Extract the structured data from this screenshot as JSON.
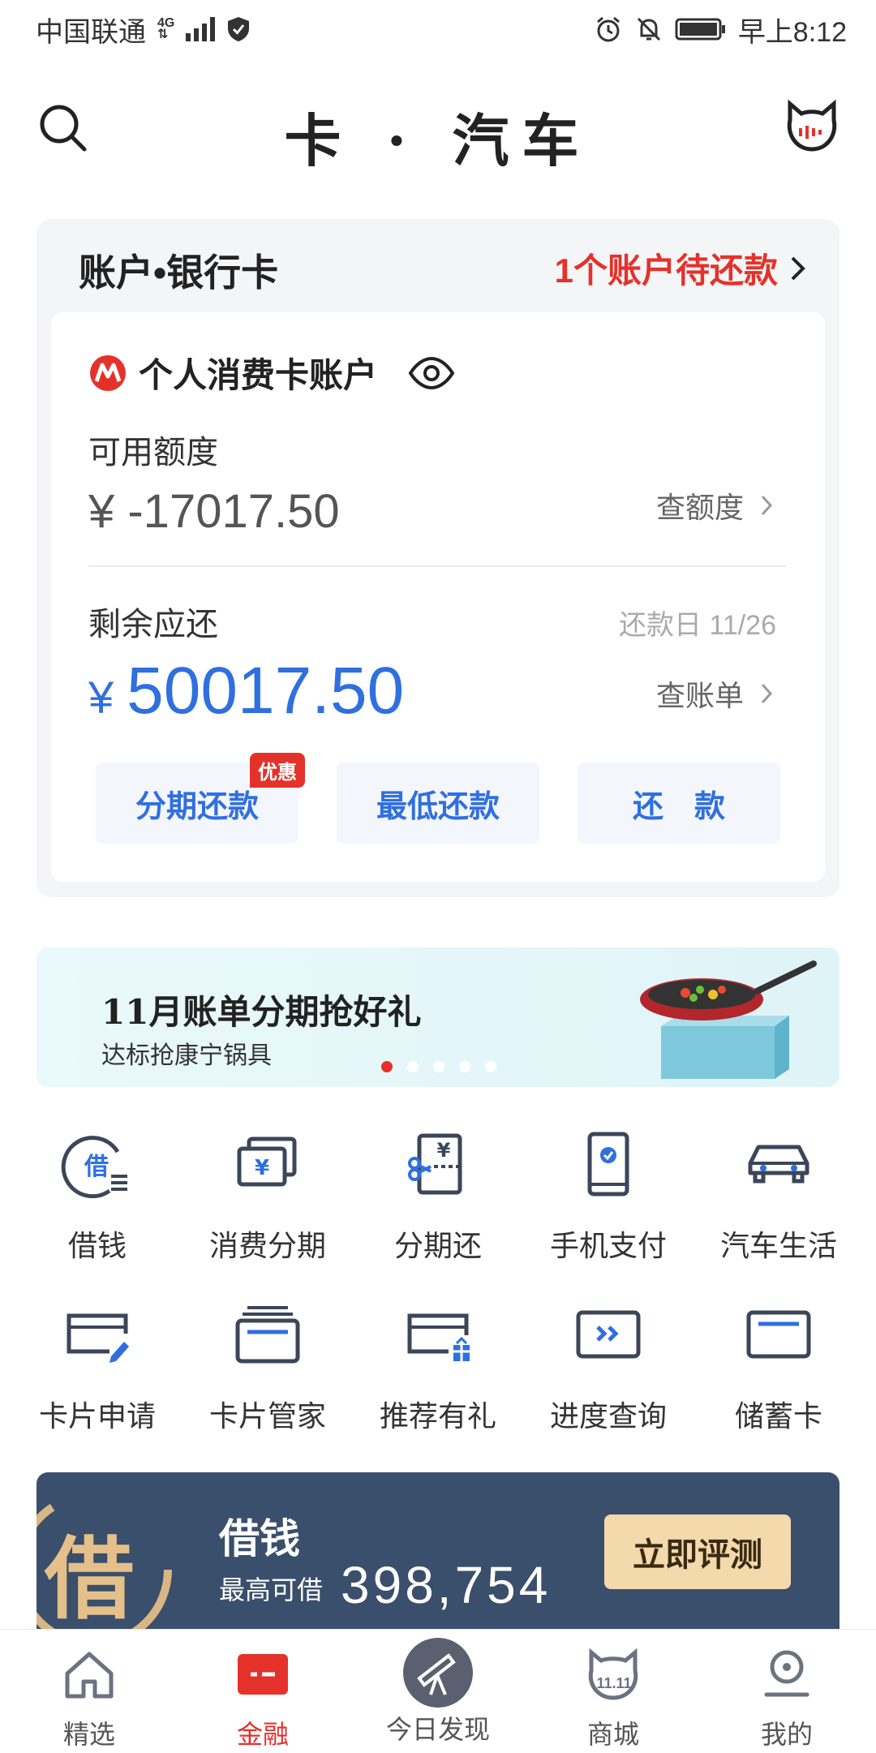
{
  "status_bar": {
    "carrier": "中国联通",
    "network_top": "4G",
    "network_bottom": "⇅",
    "time": "早上8:12"
  },
  "header": {
    "title": "卡 · 汽车"
  },
  "account": {
    "section_title": "账户•银行卡",
    "alert": "1个账户待还款",
    "card_name": "个人消费卡账户",
    "available_label": "可用额度",
    "available_value": "¥ -17017.50",
    "check_limit": "查额度",
    "remaining_label": "剩余应还",
    "due_date": "还款日 11/26",
    "remaining_currency": "¥",
    "remaining_value": "50017.50",
    "check_bill": "查账单",
    "buttons": [
      {
        "label": "分期还款",
        "badge": "优惠"
      },
      {
        "label": "最低还款"
      },
      {
        "label": "还　款"
      }
    ]
  },
  "promo_banner": {
    "title": "11月账单分期抢好礼",
    "subtitle": "达标抢康宁锅具",
    "page_count": 5,
    "active_page": 1
  },
  "shortcuts": [
    {
      "label": "借钱",
      "icon": "borrow-icon"
    },
    {
      "label": "消费分期",
      "icon": "installment-icon"
    },
    {
      "label": "分期还",
      "icon": "installment-repay-icon"
    },
    {
      "label": "手机支付",
      "icon": "mobile-pay-icon"
    },
    {
      "label": "汽车生活",
      "icon": "car-icon"
    },
    {
      "label": "卡片申请",
      "icon": "card-apply-icon"
    },
    {
      "label": "卡片管家",
      "icon": "card-manager-icon"
    },
    {
      "label": "推荐有礼",
      "icon": "referral-gift-icon"
    },
    {
      "label": "进度查询",
      "icon": "progress-query-icon"
    },
    {
      "label": "储蓄卡",
      "icon": "debit-card-icon"
    }
  ],
  "loan_banner": {
    "emblem": "借",
    "title": "借钱",
    "subtitle": "最高可借",
    "amount": "398,754",
    "button": "立即评测"
  },
  "bottom_nav": [
    {
      "label": "精选",
      "icon": "home-icon",
      "active": false
    },
    {
      "label": "金融",
      "icon": "finance-card-icon",
      "active": true
    },
    {
      "label": "今日发现",
      "icon": "telescope-icon",
      "active": false
    },
    {
      "label": "商城",
      "icon": "mall-cat-icon",
      "active": false,
      "icon_text": "11.11"
    },
    {
      "label": "我的",
      "icon": "profile-icon",
      "active": false
    }
  ],
  "colors": {
    "accent_blue": "#2f6fe0",
    "alert_red": "#e4322b",
    "loan_bg": "#3a4f6b",
    "loan_btn": "#f3d9ab"
  }
}
